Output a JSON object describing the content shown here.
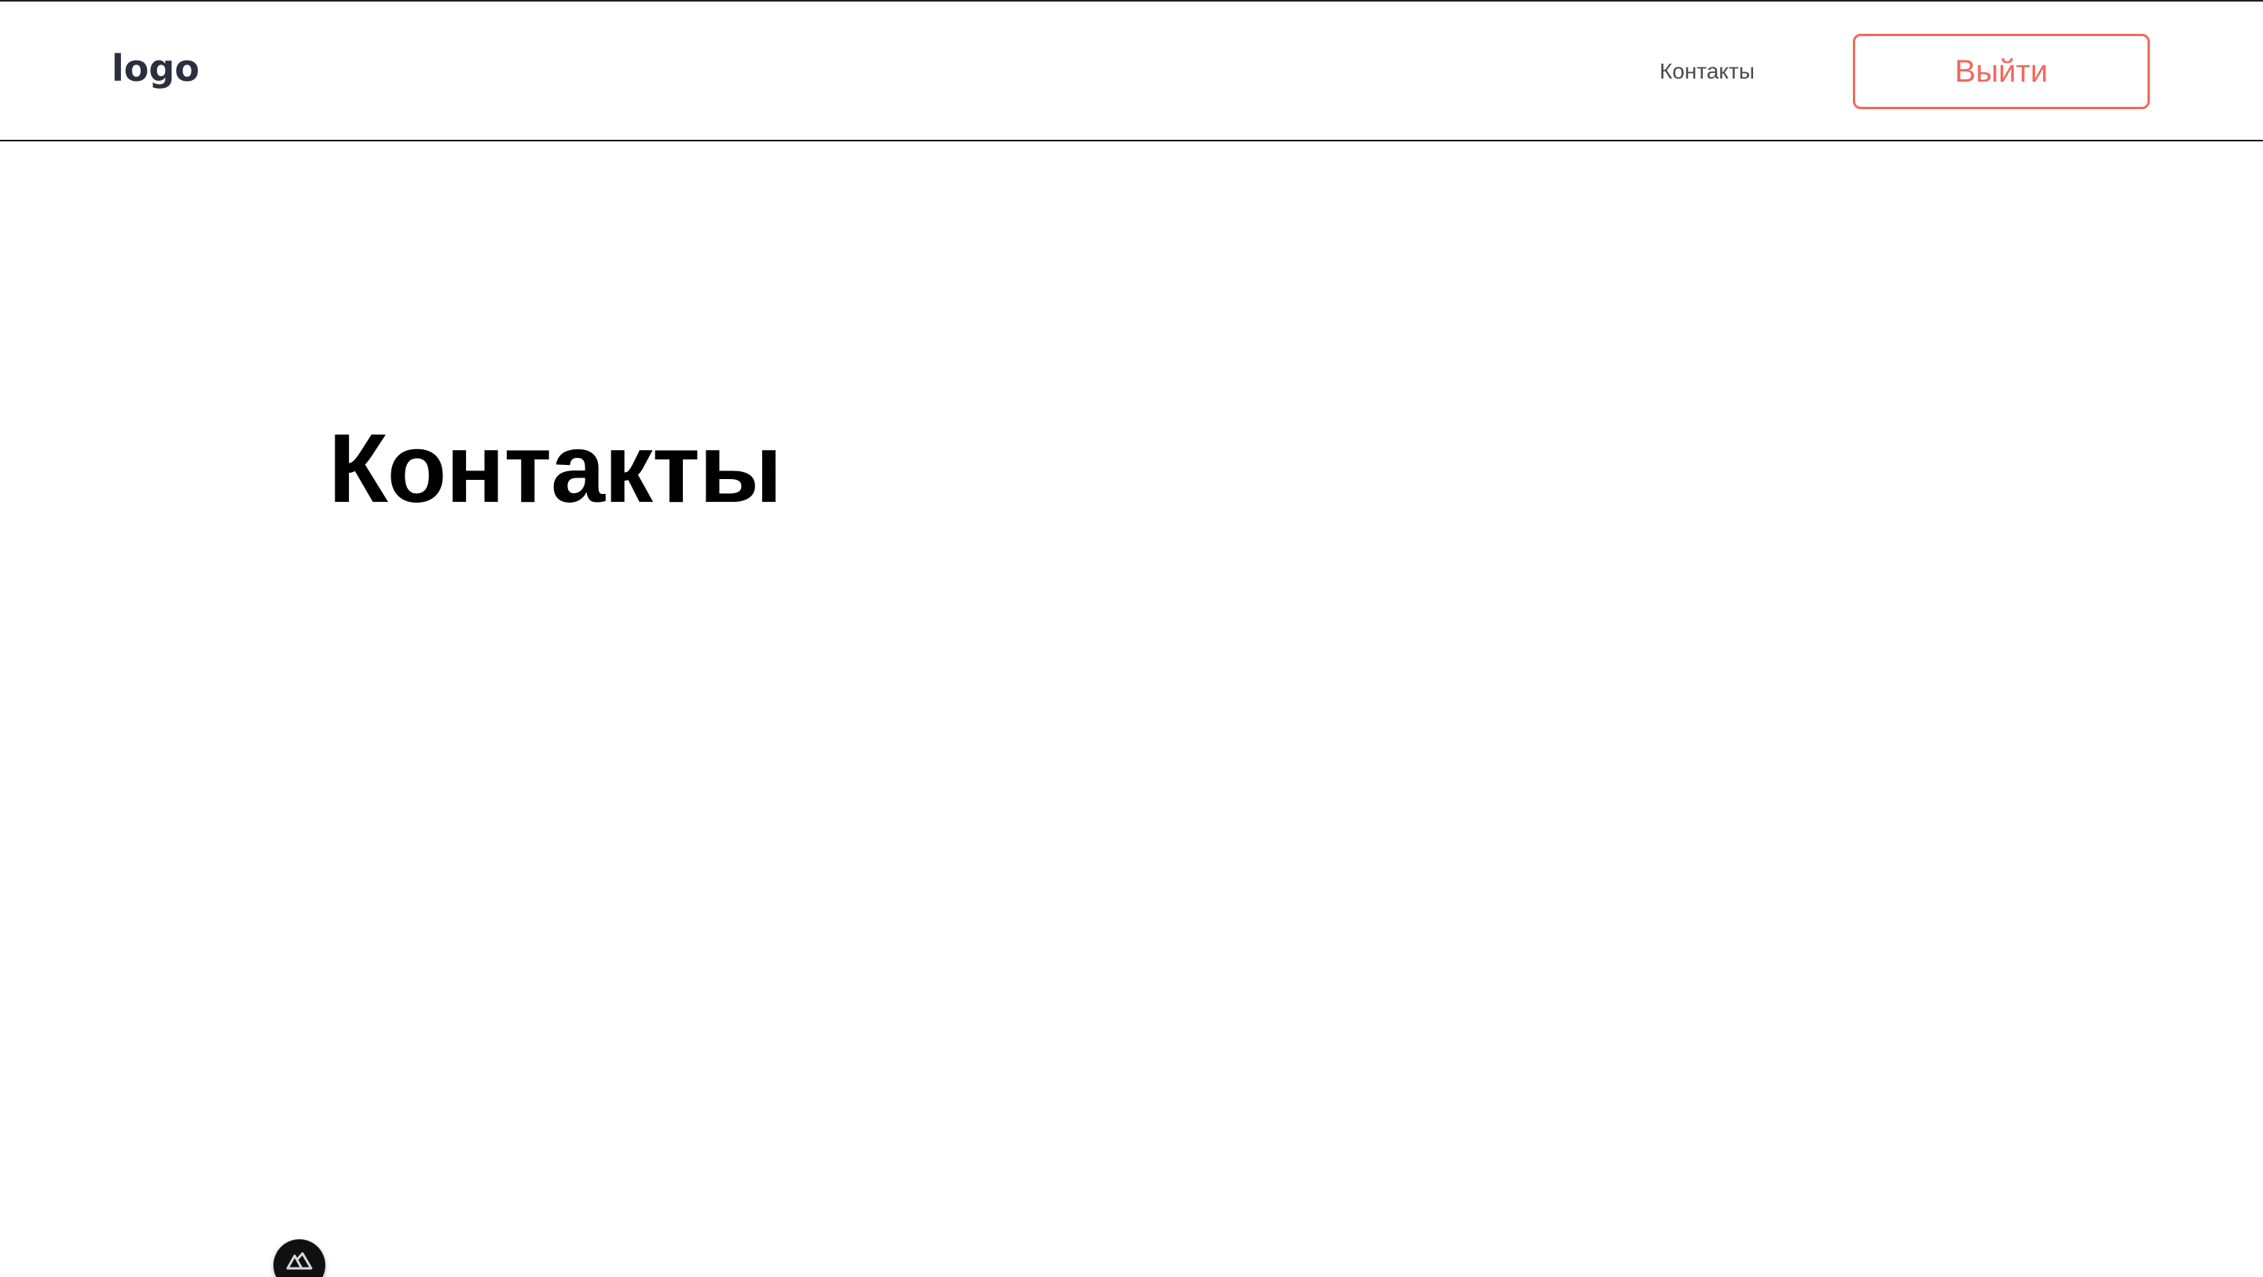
{
  "header": {
    "logo_text": "logo",
    "nav": {
      "contacts_label": "Контакты"
    },
    "logout_label": "Выйти"
  },
  "main": {
    "title": "Контакты"
  },
  "devtools": {
    "icon": "nuxt-logo-icon"
  },
  "colors": {
    "accent": "#ef6a5b",
    "logo": "#2c2f3f",
    "title": "#000000",
    "nav_text": "#4a4a4a"
  }
}
